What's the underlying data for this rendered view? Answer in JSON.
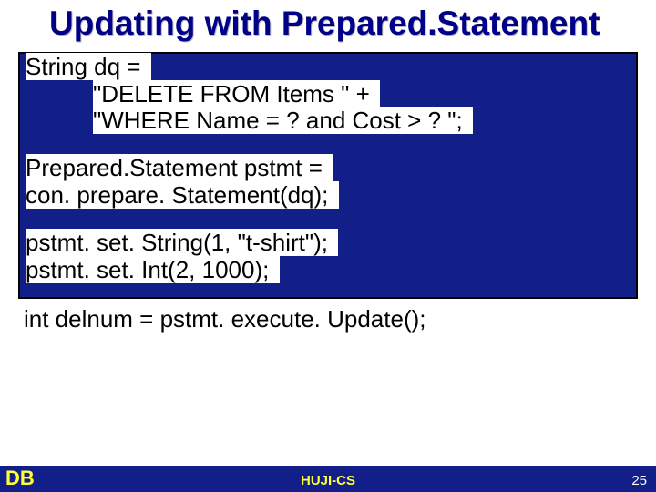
{
  "title": "Updating with Prepared.Statement",
  "code": {
    "l1": "String dq = ",
    "l2": "\"DELETE FROM Items \" + ",
    "l3": "\"WHERE Name = ? and Cost > ? \"; ",
    "l4": "Prepared.Statement pstmt = ",
    "l5": "con. prepare. Statement(dq); ",
    "l6": "pstmt. set. String(1, \"t-shirt\"); ",
    "l7": "pstmt. set. Int(2, 1000); "
  },
  "outside": "int delnum = pstmt. execute. Update();",
  "footer": {
    "left": "DB",
    "center": "HUJI-CS",
    "page": "25"
  }
}
